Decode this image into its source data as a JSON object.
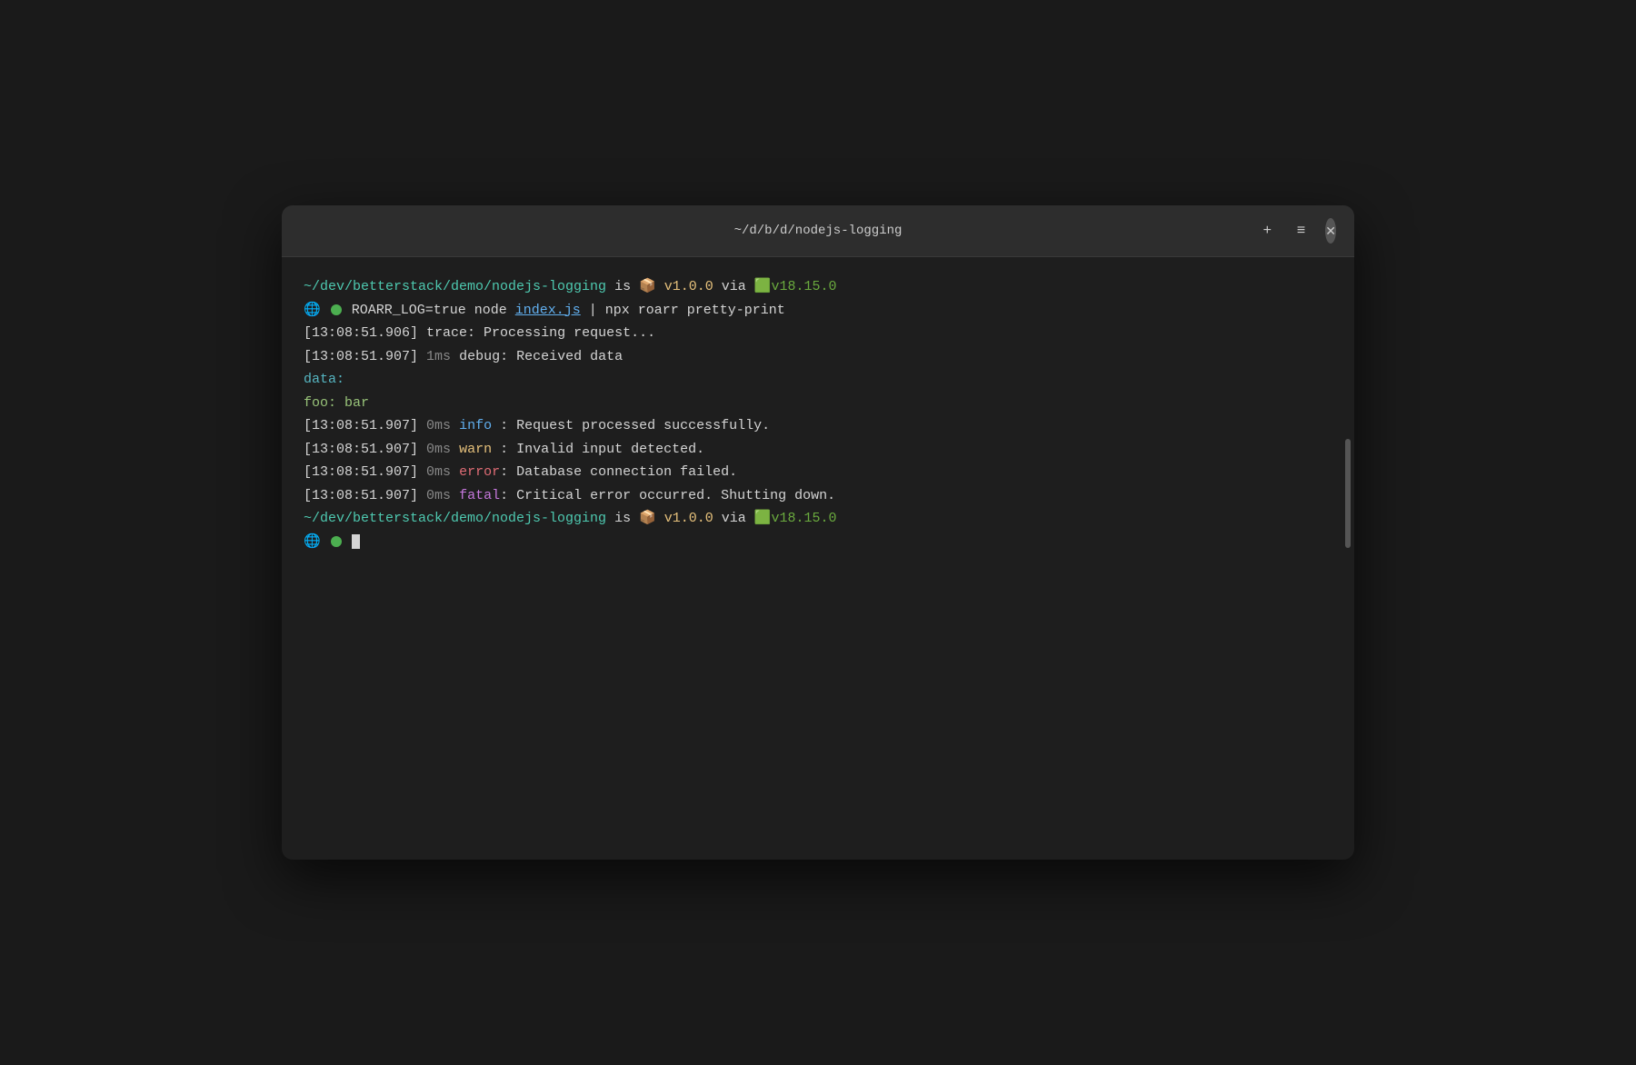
{
  "window": {
    "title": "~/d/b/d/nodejs-logging",
    "plus_btn": "+",
    "menu_btn": "≡",
    "close_btn": "✕"
  },
  "terminal": {
    "path": "~/dev/betterstack/demo/nodejs-logging",
    "is_text": " is ",
    "package_emoji": "📦",
    "version": "v1.0.0",
    "via_text": " via ",
    "node_emoji": "🟩",
    "node_version": "v18.15.0",
    "command_line": "  ROARR_LOG=true node index.js | npx roarr pretty-print",
    "index_js": "index.js",
    "log_lines": [
      {
        "timestamp": "[13:08:51.906]",
        "ms": "",
        "level": "trace",
        "separator": ":",
        "message": " Processing request..."
      },
      {
        "timestamp": "[13:08:51.907]",
        "ms": "1ms",
        "level": "debug",
        "separator": ":",
        "message": " Received data"
      }
    ],
    "data_label": "data:",
    "data_content": "  foo: bar",
    "log_lines2": [
      {
        "timestamp": "[13:08:51.907]",
        "ms": "0ms",
        "level": "info",
        "separator": " :",
        "message": " Request processed successfully."
      },
      {
        "timestamp": "[13:08:51.907]",
        "ms": "0ms",
        "level": "warn",
        "separator": " :",
        "message": " Invalid input detected."
      },
      {
        "timestamp": "[13:08:51.907]",
        "ms": "0ms",
        "level": "error",
        "separator": ":",
        "message": " Database connection failed."
      },
      {
        "timestamp": "[13:08:51.907]",
        "ms": "0ms",
        "level": "fatal",
        "separator": ":",
        "message": " Critical error occurred. Shutting down."
      }
    ],
    "prompt_char": "❯",
    "cursor_visible": true
  }
}
